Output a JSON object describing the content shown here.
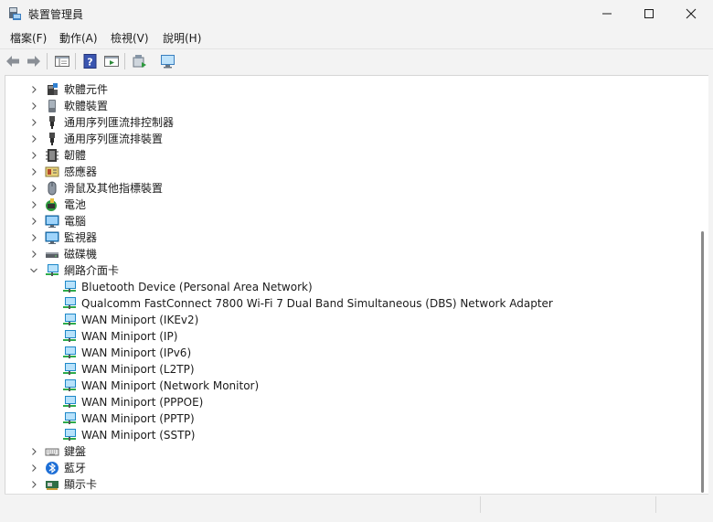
{
  "window": {
    "title": "裝置管理員",
    "minimize": "minimize-icon",
    "maximize": "maximize-icon",
    "close": "close-icon"
  },
  "menu": [
    {
      "label": "檔案(F)"
    },
    {
      "label": "動作(A)"
    },
    {
      "label": "檢視(V)"
    },
    {
      "label": "說明(H)"
    }
  ],
  "toolbar": [
    "back-arrow-icon",
    "forward-arrow-icon",
    "properties-icon",
    "help-icon",
    "view-icon",
    "update-driver-icon",
    "scan-hardware-icon"
  ],
  "tree": {
    "collapsed_before": [
      {
        "label": "軟體元件",
        "icon": "software-component-icon"
      },
      {
        "label": "軟體裝置",
        "icon": "software-device-icon"
      },
      {
        "label": "通用序列匯流排控制器",
        "icon": "usb-controller-icon"
      },
      {
        "label": "通用序列匯流排裝置",
        "icon": "usb-device-icon"
      },
      {
        "label": "韌體",
        "icon": "firmware-icon"
      },
      {
        "label": "感應器",
        "icon": "sensor-icon"
      },
      {
        "label": "滑鼠及其他指標裝置",
        "icon": "mouse-icon"
      },
      {
        "label": "電池",
        "icon": "battery-icon"
      },
      {
        "label": "電腦",
        "icon": "computer-icon"
      },
      {
        "label": "監視器",
        "icon": "monitor-icon"
      },
      {
        "label": "磁碟機",
        "icon": "disk-drive-icon"
      }
    ],
    "expanded": {
      "label": "網路介面卡",
      "icon": "network-adapter-icon",
      "children": [
        "Bluetooth Device (Personal Area Network)",
        "Qualcomm FastConnect 7800 Wi-Fi 7 Dual Band Simultaneous (DBS) Network Adapter",
        "WAN Miniport (IKEv2)",
        "WAN Miniport (IP)",
        "WAN Miniport (IPv6)",
        "WAN Miniport (L2TP)",
        "WAN Miniport (Network Monitor)",
        "WAN Miniport (PPPOE)",
        "WAN Miniport (PPTP)",
        "WAN Miniport (SSTP)"
      ]
    },
    "collapsed_after": [
      {
        "label": "鍵盤",
        "icon": "keyboard-icon"
      },
      {
        "label": "藍牙",
        "icon": "bluetooth-icon"
      },
      {
        "label": "顯示卡",
        "icon": "display-adapter-icon"
      }
    ]
  },
  "colors": {
    "chrome": "#f3f3f3",
    "tree_bg": "#ffffff",
    "net_blue": "#1e88c8",
    "net_green": "#2eaa4a"
  }
}
